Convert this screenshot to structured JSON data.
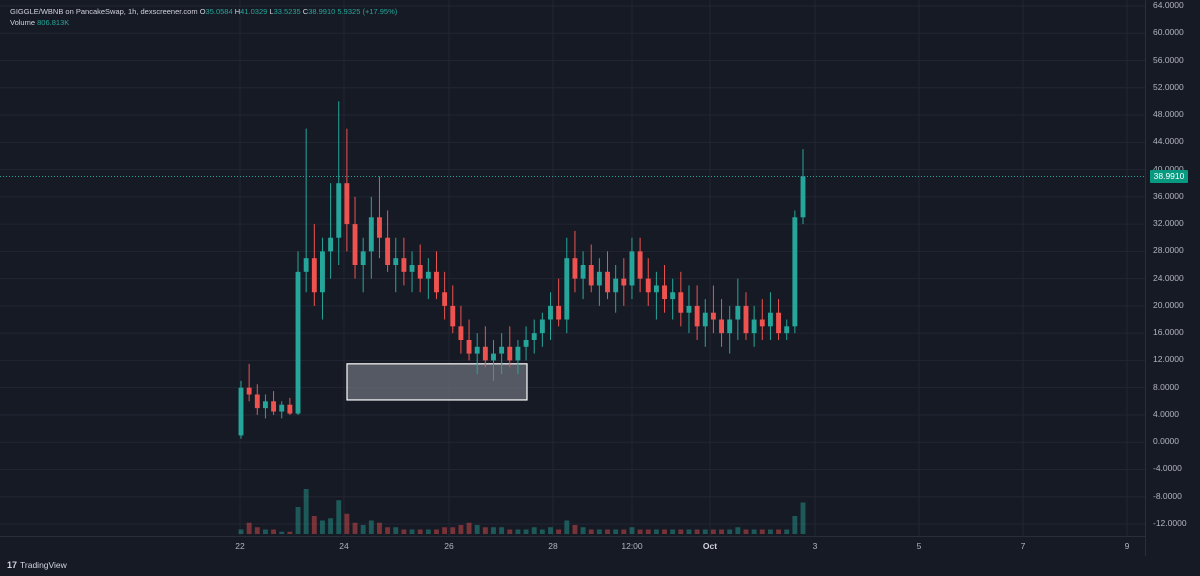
{
  "legend": {
    "symbol": "GIGGLE/WBNB on PancakeSwap, 1h, dexscreener.com",
    "open_label": "O",
    "open": "35.0584",
    "high_label": "H",
    "high": "41.0329",
    "low_label": "L",
    "low": "33.5235",
    "close_label": "C",
    "close": "38.9910",
    "change": "5.9325 (+17.95%)",
    "volume_label": "Volume",
    "volume": "806.813K"
  },
  "price_axis": {
    "labels": [
      "64.0000",
      "60.0000",
      "56.0000",
      "52.0000",
      "48.0000",
      "44.0000",
      "40.0000",
      "36.0000",
      "32.0000",
      "28.0000",
      "24.0000",
      "20.0000",
      "16.0000",
      "12.0000",
      "8.0000",
      "4.0000",
      "0.0000",
      "-4.0000",
      "-8.0000",
      "-12.0000"
    ],
    "current_price": "38.9910"
  },
  "time_axis": {
    "labels": [
      {
        "text": "22",
        "bold": false
      },
      {
        "text": "24",
        "bold": false
      },
      {
        "text": "26",
        "bold": false
      },
      {
        "text": "28",
        "bold": false
      },
      {
        "text": "12:00",
        "bold": false
      },
      {
        "text": "Oct",
        "bold": true
      },
      {
        "text": "3",
        "bold": false
      },
      {
        "text": "5",
        "bold": false
      },
      {
        "text": "7",
        "bold": false
      },
      {
        "text": "9",
        "bold": false
      }
    ]
  },
  "branding": {
    "logo_mark": "17",
    "name": "TradingView"
  },
  "colors": {
    "up": "#26a69a",
    "down": "#ef5350",
    "background": "#161a25",
    "grid": "#232632",
    "highlight_box": "#6b6f78"
  },
  "chart_data": {
    "type": "candlestick",
    "ylim": [
      -12,
      64
    ],
    "last_price": 38.991,
    "ohlc": [
      [
        1.0,
        9.0,
        0.5,
        8.0
      ],
      [
        8.0,
        11.5,
        6.0,
        7.0
      ],
      [
        7.0,
        8.5,
        4.0,
        5.0
      ],
      [
        5.0,
        7.0,
        3.5,
        6.0
      ],
      [
        6.0,
        7.5,
        4.0,
        4.5
      ],
      [
        4.5,
        6.0,
        3.5,
        5.5
      ],
      [
        5.5,
        6.5,
        4.0,
        4.2
      ],
      [
        4.2,
        28,
        4.0,
        25
      ],
      [
        25,
        46,
        22,
        27
      ],
      [
        27,
        32,
        20,
        22
      ],
      [
        22,
        30,
        18,
        28
      ],
      [
        28,
        38,
        24,
        30
      ],
      [
        30,
        50,
        26,
        38
      ],
      [
        38,
        46,
        28,
        32
      ],
      [
        32,
        36,
        24,
        26
      ],
      [
        26,
        30,
        22,
        28
      ],
      [
        28,
        36,
        24,
        33
      ],
      [
        33,
        39,
        27,
        30
      ],
      [
        30,
        34,
        25,
        26
      ],
      [
        26,
        30,
        22,
        27
      ],
      [
        27,
        30,
        23,
        25
      ],
      [
        25,
        28,
        22,
        26
      ],
      [
        26,
        29,
        22,
        24
      ],
      [
        24,
        27,
        21,
        25
      ],
      [
        25,
        28,
        21,
        22
      ],
      [
        22,
        25,
        18,
        20
      ],
      [
        20,
        23,
        16,
        17
      ],
      [
        17,
        20,
        13,
        15
      ],
      [
        15,
        18,
        12,
        13
      ],
      [
        13,
        16,
        10,
        14
      ],
      [
        14,
        17,
        11,
        12
      ],
      [
        12,
        15,
        9,
        13
      ],
      [
        13,
        16,
        10,
        14
      ],
      [
        14,
        17,
        11,
        12
      ],
      [
        12,
        15,
        10,
        14
      ],
      [
        14,
        17,
        12,
        15
      ],
      [
        15,
        18,
        13,
        16
      ],
      [
        16,
        19,
        14,
        18
      ],
      [
        18,
        22,
        15,
        20
      ],
      [
        20,
        24,
        17,
        18
      ],
      [
        18,
        30,
        16,
        27
      ],
      [
        27,
        31,
        22,
        24
      ],
      [
        24,
        28,
        21,
        26
      ],
      [
        26,
        29,
        22,
        23
      ],
      [
        23,
        27,
        20,
        25
      ],
      [
        25,
        28,
        21,
        22
      ],
      [
        22,
        26,
        19,
        24
      ],
      [
        24,
        27,
        20,
        23
      ],
      [
        23,
        30,
        21,
        28
      ],
      [
        28,
        30,
        22,
        24
      ],
      [
        24,
        27,
        20,
        22
      ],
      [
        22,
        25,
        18,
        23
      ],
      [
        23,
        26,
        19,
        21
      ],
      [
        21,
        24,
        18,
        22
      ],
      [
        22,
        25,
        17,
        19
      ],
      [
        19,
        23,
        16,
        20
      ],
      [
        20,
        23,
        15,
        17
      ],
      [
        17,
        21,
        14,
        19
      ],
      [
        19,
        23,
        16,
        18
      ],
      [
        18,
        21,
        14,
        16
      ],
      [
        16,
        20,
        13,
        18
      ],
      [
        18,
        24,
        15,
        20
      ],
      [
        20,
        22,
        15,
        16
      ],
      [
        16,
        20,
        14,
        18
      ],
      [
        18,
        21,
        15,
        17
      ],
      [
        17,
        22,
        15,
        19
      ],
      [
        19,
        21,
        15,
        16
      ],
      [
        16,
        18,
        15,
        17
      ],
      [
        17,
        34,
        16,
        33
      ],
      [
        33,
        43,
        32,
        39
      ]
    ],
    "volume": [
      2,
      5,
      3,
      2,
      2,
      1,
      1,
      12,
      20,
      8,
      6,
      7,
      15,
      9,
      5,
      4,
      6,
      5,
      3,
      3,
      2,
      2,
      2,
      2,
      2,
      3,
      3,
      4,
      5,
      4,
      3,
      3,
      3,
      2,
      2,
      2,
      3,
      2,
      3,
      2,
      6,
      4,
      3,
      2,
      2,
      2,
      2,
      2,
      3,
      2,
      2,
      2,
      2,
      2,
      2,
      2,
      2,
      2,
      2,
      2,
      2,
      3,
      2,
      2,
      2,
      2,
      2,
      2,
      8,
      14
    ],
    "highlight_box": {
      "y_low": 6.2,
      "y_high": 11.5
    }
  }
}
